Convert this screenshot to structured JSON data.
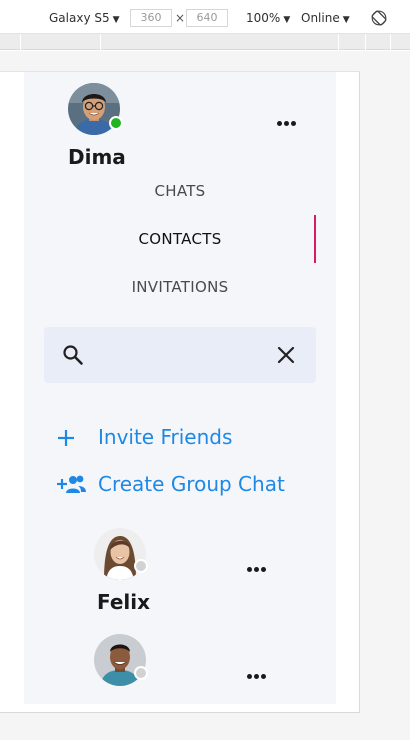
{
  "toolbar": {
    "device": "Galaxy S5",
    "width": "360",
    "height": "640",
    "times": "×",
    "zoom": "100%",
    "network": "Online"
  },
  "profile": {
    "name": "Dima",
    "status": "online",
    "status_color": "#22b422"
  },
  "tabs": [
    {
      "label": "CHATS",
      "active": false
    },
    {
      "label": "CONTACTS",
      "active": true
    },
    {
      "label": "INVITATIONS",
      "active": false
    }
  ],
  "search": {
    "value": ""
  },
  "actions": {
    "invite_label": "Invite Friends",
    "create_group_label": "Create Group Chat"
  },
  "contacts": [
    {
      "name": "Felix",
      "status": "offline"
    },
    {
      "name": "",
      "status": "offline"
    }
  ],
  "colors": {
    "accent": "#1e88e5",
    "tab_indicator": "#d81b60",
    "offline": "#d2d2d2"
  }
}
